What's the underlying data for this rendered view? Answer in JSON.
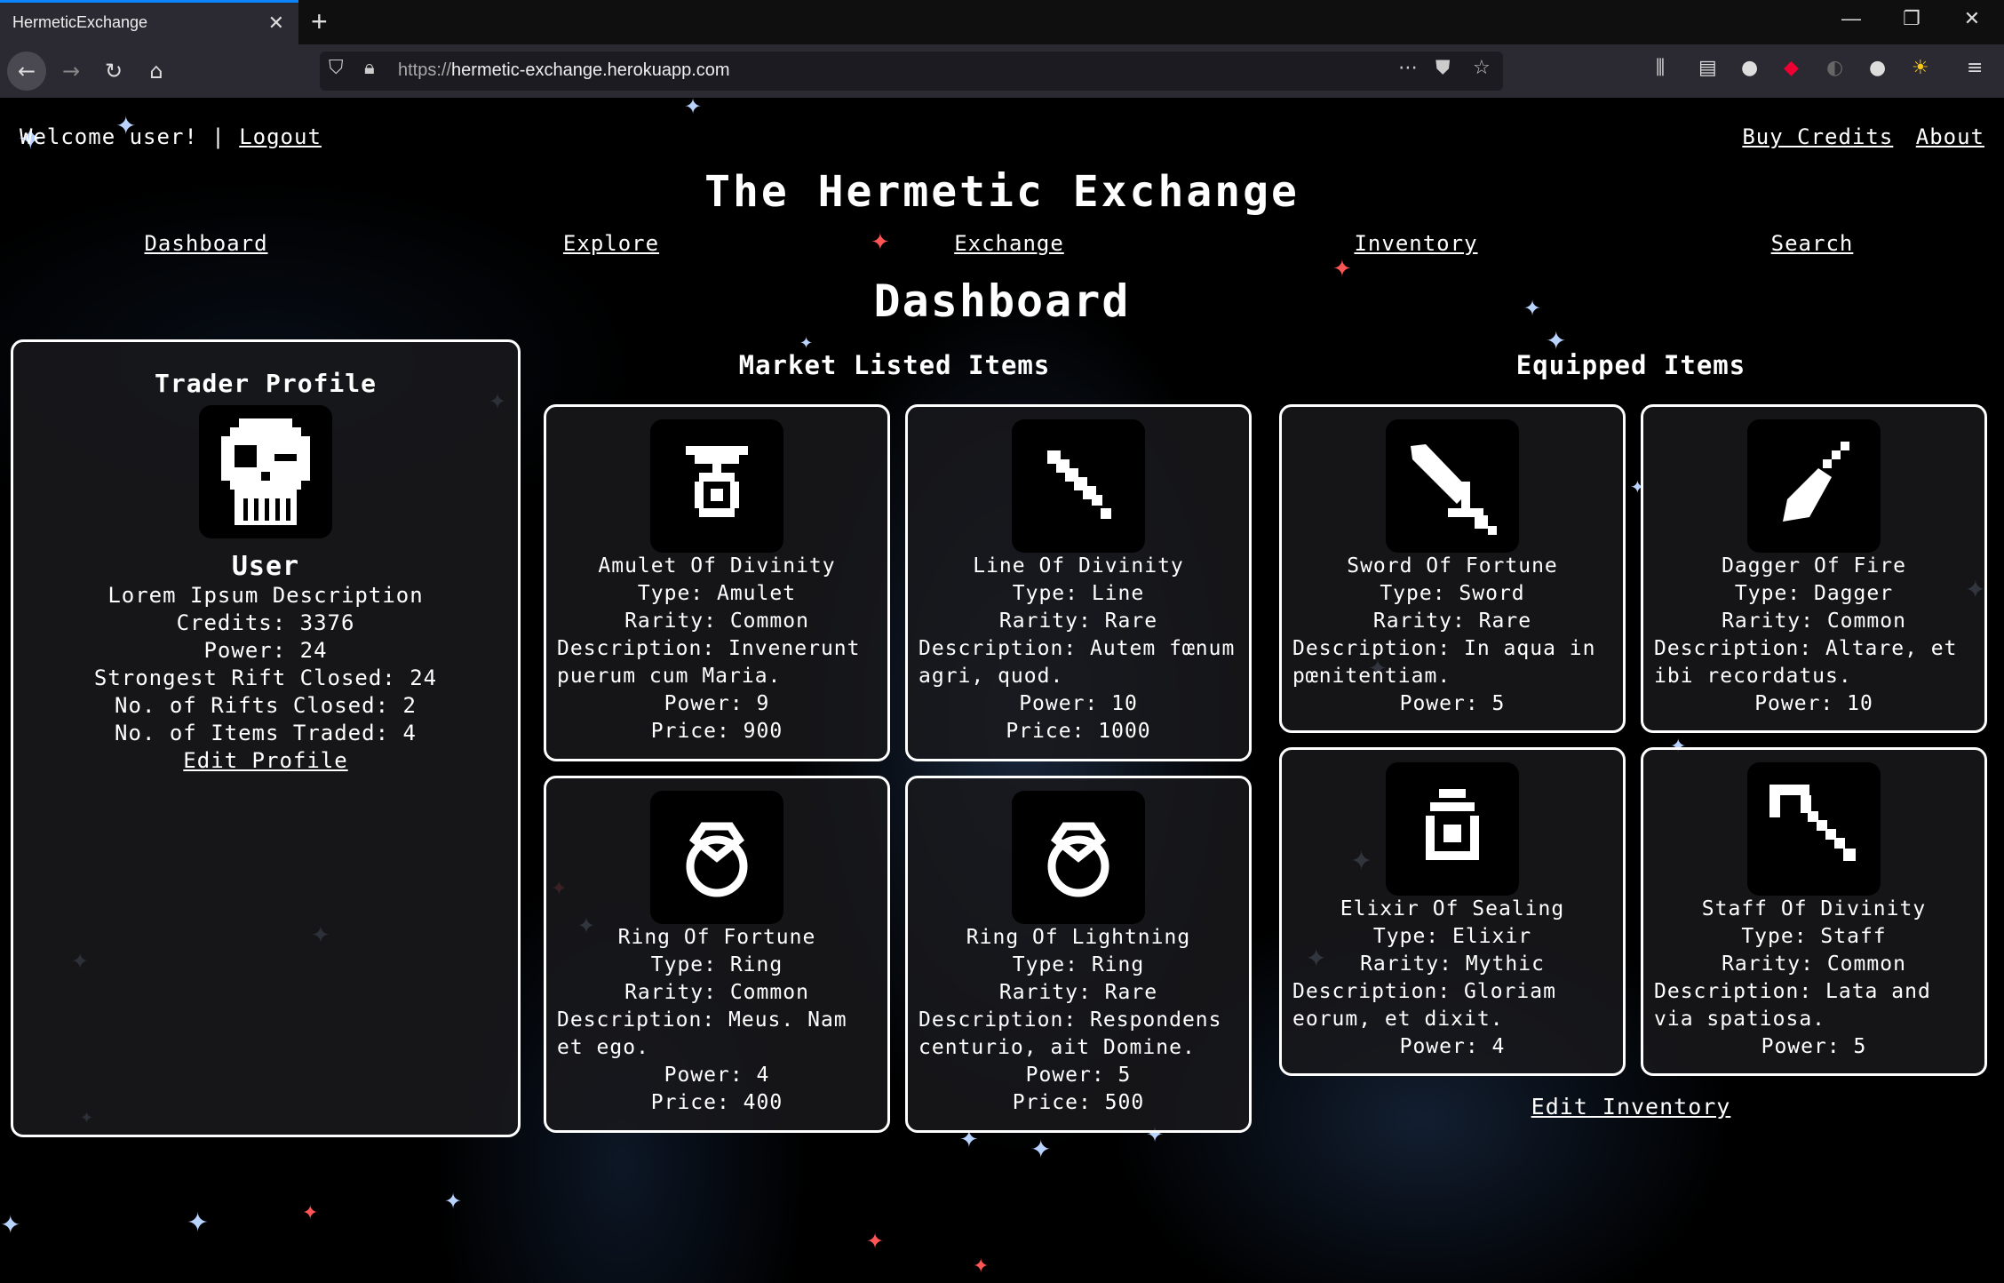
{
  "browser": {
    "tab_title": "HermeticExchange",
    "url_scheme": "https://",
    "url_host": "hermetic-exchange.herokuapp.com"
  },
  "header": {
    "welcome": "Welcome user!",
    "separator": "|",
    "logout": "Logout",
    "buy_credits": "Buy Credits",
    "about": "About",
    "site_title": "The Hermetic Exchange"
  },
  "nav": [
    "Dashboard",
    "Explore",
    "Exchange",
    "Inventory",
    "Search"
  ],
  "page_title": "Dashboard",
  "profile": {
    "heading": "Trader Profile",
    "name": "User",
    "description": "Lorem Ipsum Description",
    "credits": "Credits: 3376",
    "power": "Power: 24",
    "strongest_rift": "Strongest Rift Closed: 24",
    "rifts_closed": "No. of Rifts Closed: 2",
    "items_traded": "No. of Items Traded: 4",
    "edit_link": "Edit Profile"
  },
  "market": {
    "heading": "Market Listed Items",
    "items": [
      {
        "name": "Amulet Of Divinity",
        "type": "Type: Amulet",
        "rarity": "Rarity: Common",
        "description": "Description: Invenerunt puerum cum Maria.",
        "power": "Power: 9",
        "price": "Price: 900",
        "icon": "amulet-icon"
      },
      {
        "name": "Line Of Divinity",
        "type": "Type: Line",
        "rarity": "Rarity: Rare",
        "description": "Description: Autem fœnum agri, quod.",
        "power": "Power: 10",
        "price": "Price: 1000",
        "icon": "line-icon"
      },
      {
        "name": "Ring Of Fortune",
        "type": "Type: Ring",
        "rarity": "Rarity: Common",
        "description": "Description: Meus. Nam et ego.",
        "power": "Power: 4",
        "price": "Price: 400",
        "icon": "ring-icon"
      },
      {
        "name": "Ring Of Lightning",
        "type": "Type: Ring",
        "rarity": "Rarity: Rare",
        "description": "Description: Respondens centurio, ait Domine.",
        "power": "Power: 5",
        "price": "Price: 500",
        "icon": "ring-icon"
      }
    ]
  },
  "equipped": {
    "heading": "Equipped Items",
    "items": [
      {
        "name": "Sword Of Fortune",
        "type": "Type: Sword",
        "rarity": "Rarity: Rare",
        "description": "Description: In aqua in pœnitentiam.",
        "power": "Power: 5",
        "icon": "sword-icon"
      },
      {
        "name": "Dagger Of Fire",
        "type": "Type: Dagger",
        "rarity": "Rarity: Common",
        "description": "Description: Altare, et ibi recordatus.",
        "power": "Power: 10",
        "icon": "dagger-icon"
      },
      {
        "name": "Elixir Of Sealing",
        "type": "Type: Elixir",
        "rarity": "Rarity: Mythic",
        "description": "Description: Gloriam eorum, et dixit.",
        "power": "Power: 4",
        "icon": "elixir-icon"
      },
      {
        "name": "Staff Of Divinity",
        "type": "Type: Staff",
        "rarity": "Rarity: Common",
        "description": "Description: Lata and via spatiosa.",
        "power": "Power: 5",
        "icon": "staff-icon"
      }
    ],
    "edit_link": "Edit Inventory"
  }
}
